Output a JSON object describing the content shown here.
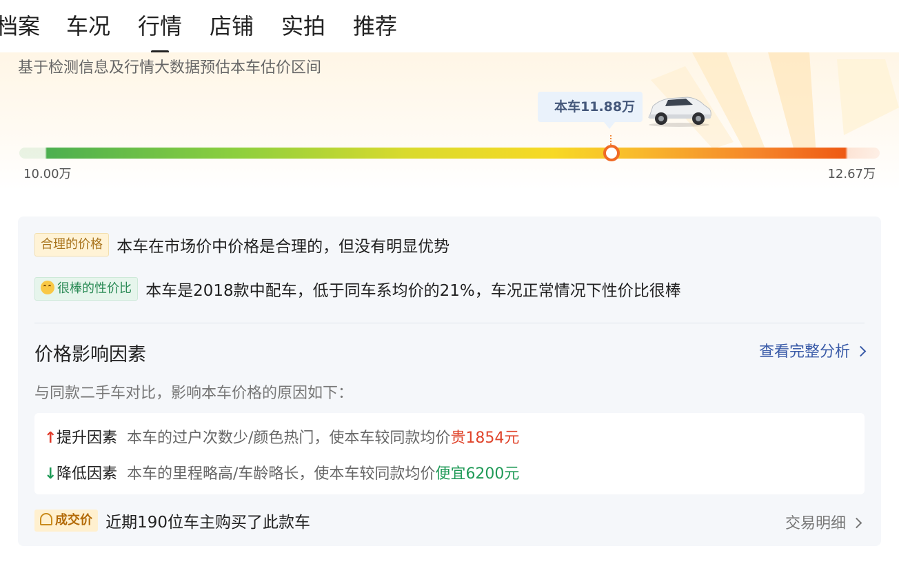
{
  "tabs": [
    {
      "label": "档案"
    },
    {
      "label": "车况"
    },
    {
      "label": "行情",
      "active": true
    },
    {
      "label": "店铺"
    },
    {
      "label": "实拍"
    },
    {
      "label": "推荐"
    }
  ],
  "estimate": {
    "subtitle": "基于检测信息及行情大数据预估本车估价区间",
    "car_label": "本车11.88万",
    "car_price_wan": 11.88,
    "min_label": "10.00万",
    "max_label": "12.67万",
    "min_value": 10.0,
    "max_value": 12.67
  },
  "verdicts": [
    {
      "tag": "合理的价格",
      "text": "本车在市场价中价格是合理的，但没有明显优势"
    },
    {
      "tag": "很棒的性价比",
      "icon": "smiling-face-icon",
      "text": "本车是2018款中配车，低于同车系均价的21%，车况正常情况下性价比很棒"
    }
  ],
  "factors": {
    "title": "价格影响因素",
    "link": "查看完整分析",
    "desc": "与同款二手车对比，影响本车价格的原因如下：",
    "up": {
      "label": "提升因素",
      "desc": "本车的过户次数少/颜色热门，使本车较同款均价",
      "impact": "贵1854元"
    },
    "down": {
      "label": "降低因素",
      "desc": "本车的里程略高/车龄略长，使本车较同款均价",
      "impact": "便宜6200元"
    }
  },
  "deal": {
    "tag": "成交价",
    "text": "近期190位车主购买了此款车",
    "link": "交易明细"
  },
  "colors": {
    "accent_blue": "#3a5ba8",
    "price_up": "#e0452c",
    "price_down": "#1f9a57",
    "marker": "#f06a25"
  }
}
